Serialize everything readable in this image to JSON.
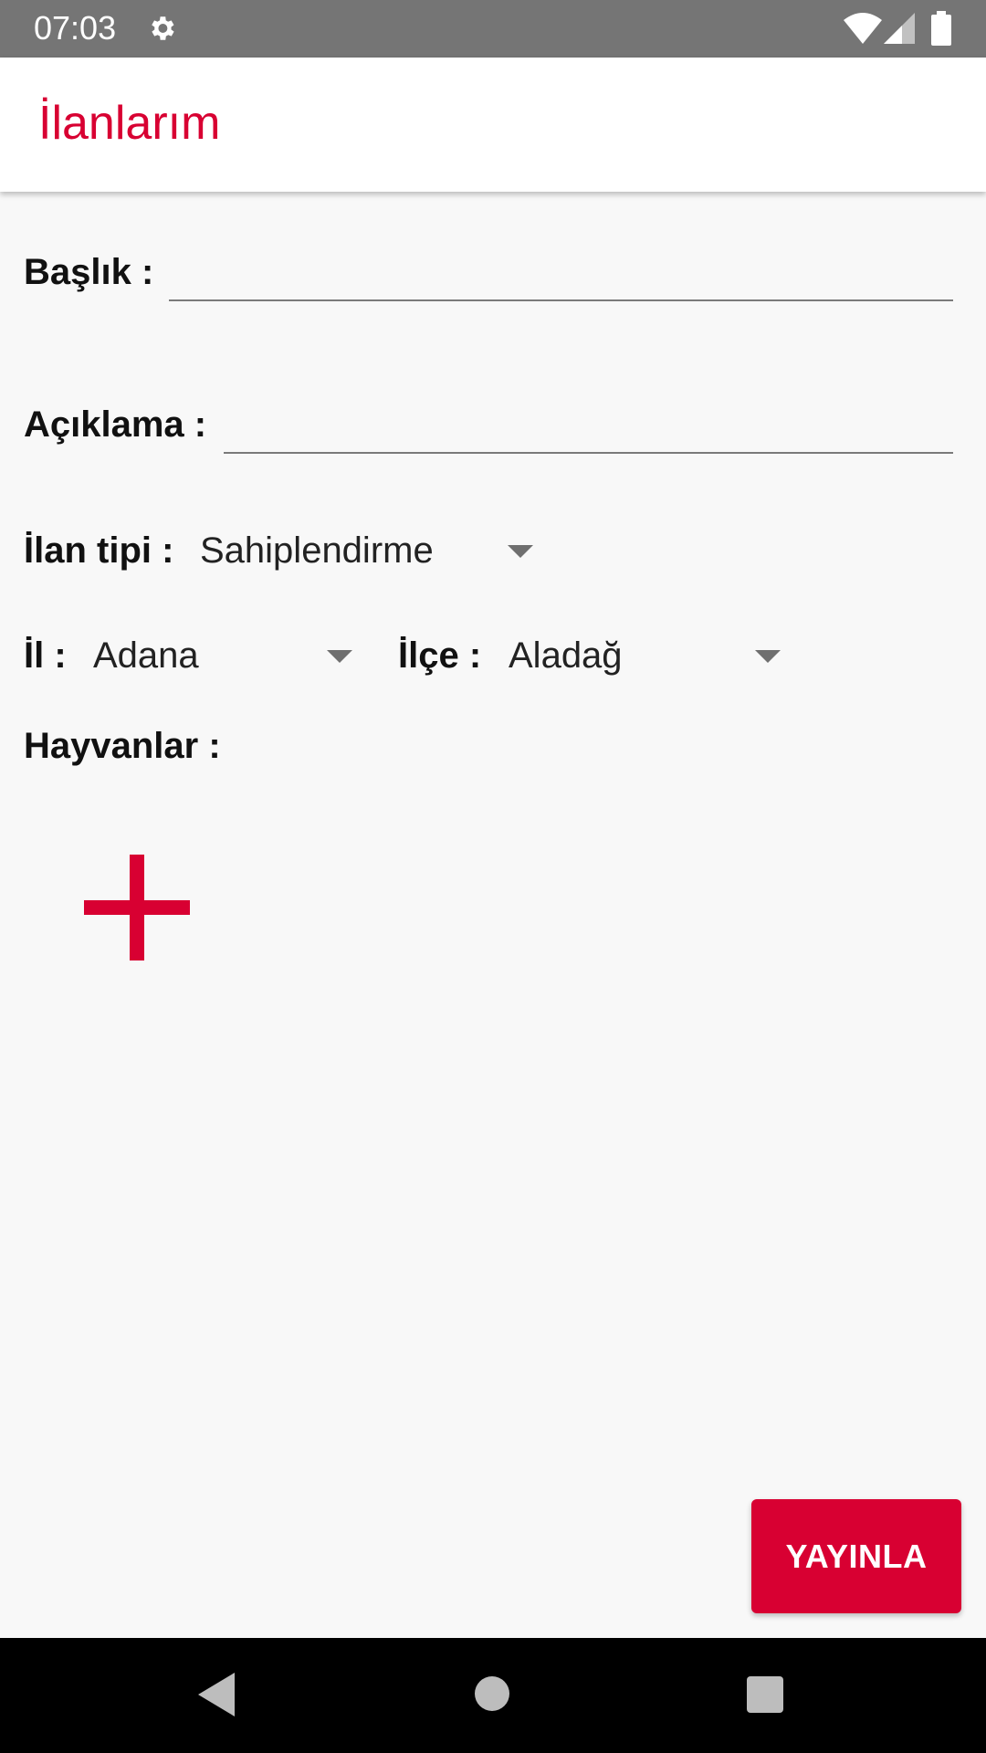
{
  "status_bar": {
    "time": "07:03",
    "icons": [
      "gear-icon",
      "wifi-icon",
      "signal-icon",
      "battery-icon"
    ]
  },
  "app_bar": {
    "title": "İlanlarım"
  },
  "form": {
    "title_label": "Başlık :",
    "title_value": "",
    "description_label": "Açıklama :",
    "description_value": "",
    "listing_type_label": "İlan tipi :",
    "listing_type_value": "Sahiplendirme",
    "province_label": "İl :",
    "province_value": "Adana",
    "district_label": "İlçe :",
    "district_value": "Aladağ",
    "animals_label": "Hayvanlar :"
  },
  "actions": {
    "publish_label": "YAYINLA"
  },
  "nav": {
    "icons": [
      "back-icon",
      "home-icon",
      "recents-icon"
    ]
  },
  "colors": {
    "accent": "#d80032",
    "status_bar": "#757575",
    "background": "#f8f8f8",
    "nav_bar": "#000000"
  }
}
